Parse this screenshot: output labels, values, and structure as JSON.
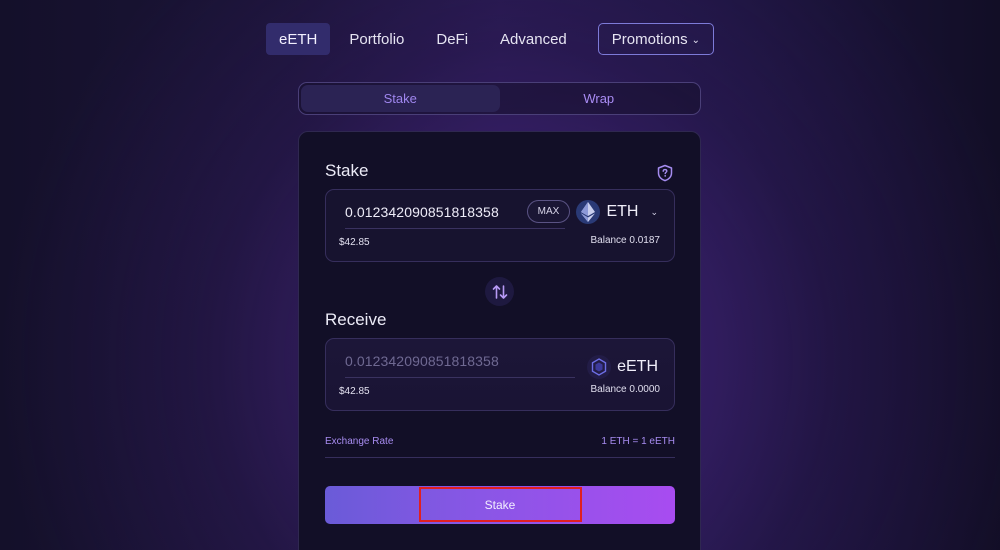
{
  "nav": {
    "items": [
      {
        "label": "eETH",
        "active": true
      },
      {
        "label": "Portfolio",
        "active": false
      },
      {
        "label": "DeFi",
        "active": false
      },
      {
        "label": "Advanced",
        "active": false
      }
    ],
    "promotions_label": "Promotions"
  },
  "tabs": [
    {
      "label": "Stake",
      "active": true
    },
    {
      "label": "Wrap",
      "active": false
    }
  ],
  "stake": {
    "title": "Stake",
    "amount": "0.012342090851818358",
    "max_label": "MAX",
    "token": "ETH",
    "usd": "$42.85",
    "balance": "Balance 0.0187"
  },
  "receive": {
    "title": "Receive",
    "amount": "0.012342090851818358",
    "token": "eETH",
    "usd": "$42.85",
    "balance": "Balance 0.0000"
  },
  "exchange": {
    "label": "Exchange Rate",
    "value": "1 ETH = 1 eETH"
  },
  "action": {
    "stake_label": "Stake"
  },
  "icons": {
    "shield": "shield-question-icon",
    "swap": "swap-arrows-icon",
    "eth": "eth-logo-icon",
    "eeth": "eeth-logo-icon",
    "chevron": "chevron-down-icon"
  },
  "colors": {
    "accent": "#a84cf0",
    "active_nav": "#322c6c",
    "card_bg": "#120f27",
    "highlight": "#e02020"
  }
}
